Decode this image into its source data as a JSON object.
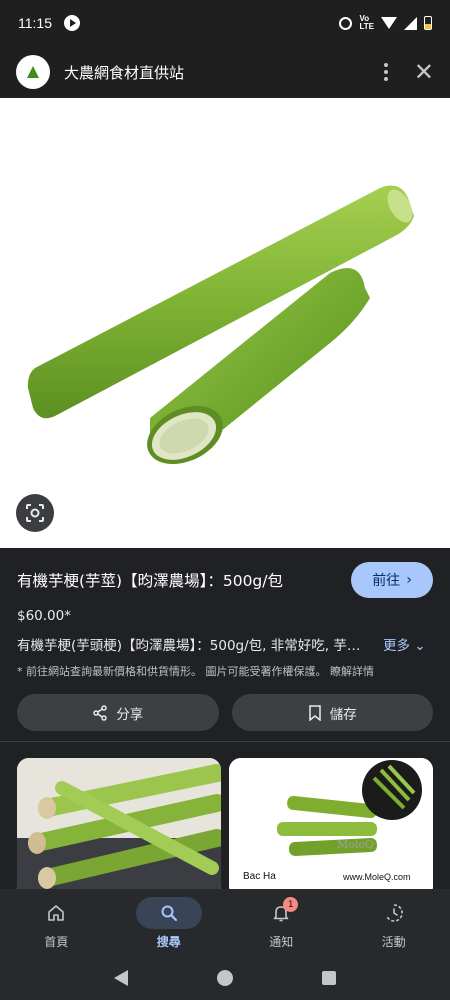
{
  "status_bar": {
    "time": "11:15",
    "network": "LTE",
    "network_prefix": "Vo"
  },
  "header": {
    "site_name": "大農網食材直供站"
  },
  "product": {
    "title": "有機芋梗(芋莖)【昀澤農場】：500g/包",
    "visit_label": "前往",
    "price": "$60.00*",
    "description": "有機芋梗(芋頭梗)【昀澤農場】：500g/包, 非常好吃, 芋…",
    "more_label": "更多",
    "notice": "* 前往網站查詢最新價格和供貨情形。 圖片可能受著作權保護。",
    "learn_more": "瞭解詳情",
    "share_label": "分享",
    "save_label": "儲存"
  },
  "results": [
    {
      "caption": ""
    },
    {
      "caption_left": "Bac Ha",
      "caption_right": "www.MoleQ.com",
      "watermark": "MoleQ"
    }
  ],
  "bottom_nav": {
    "items": [
      {
        "label": "首頁",
        "icon": "home-icon",
        "active": false
      },
      {
        "label": "搜尋",
        "icon": "search-icon",
        "active": true
      },
      {
        "label": "通知",
        "icon": "bell-icon",
        "active": false,
        "badge": "1"
      },
      {
        "label": "活動",
        "icon": "activity-icon",
        "active": false
      }
    ]
  },
  "colors": {
    "accent": "#a8c7fa",
    "background": "#202124",
    "badge": "#f28b82"
  }
}
